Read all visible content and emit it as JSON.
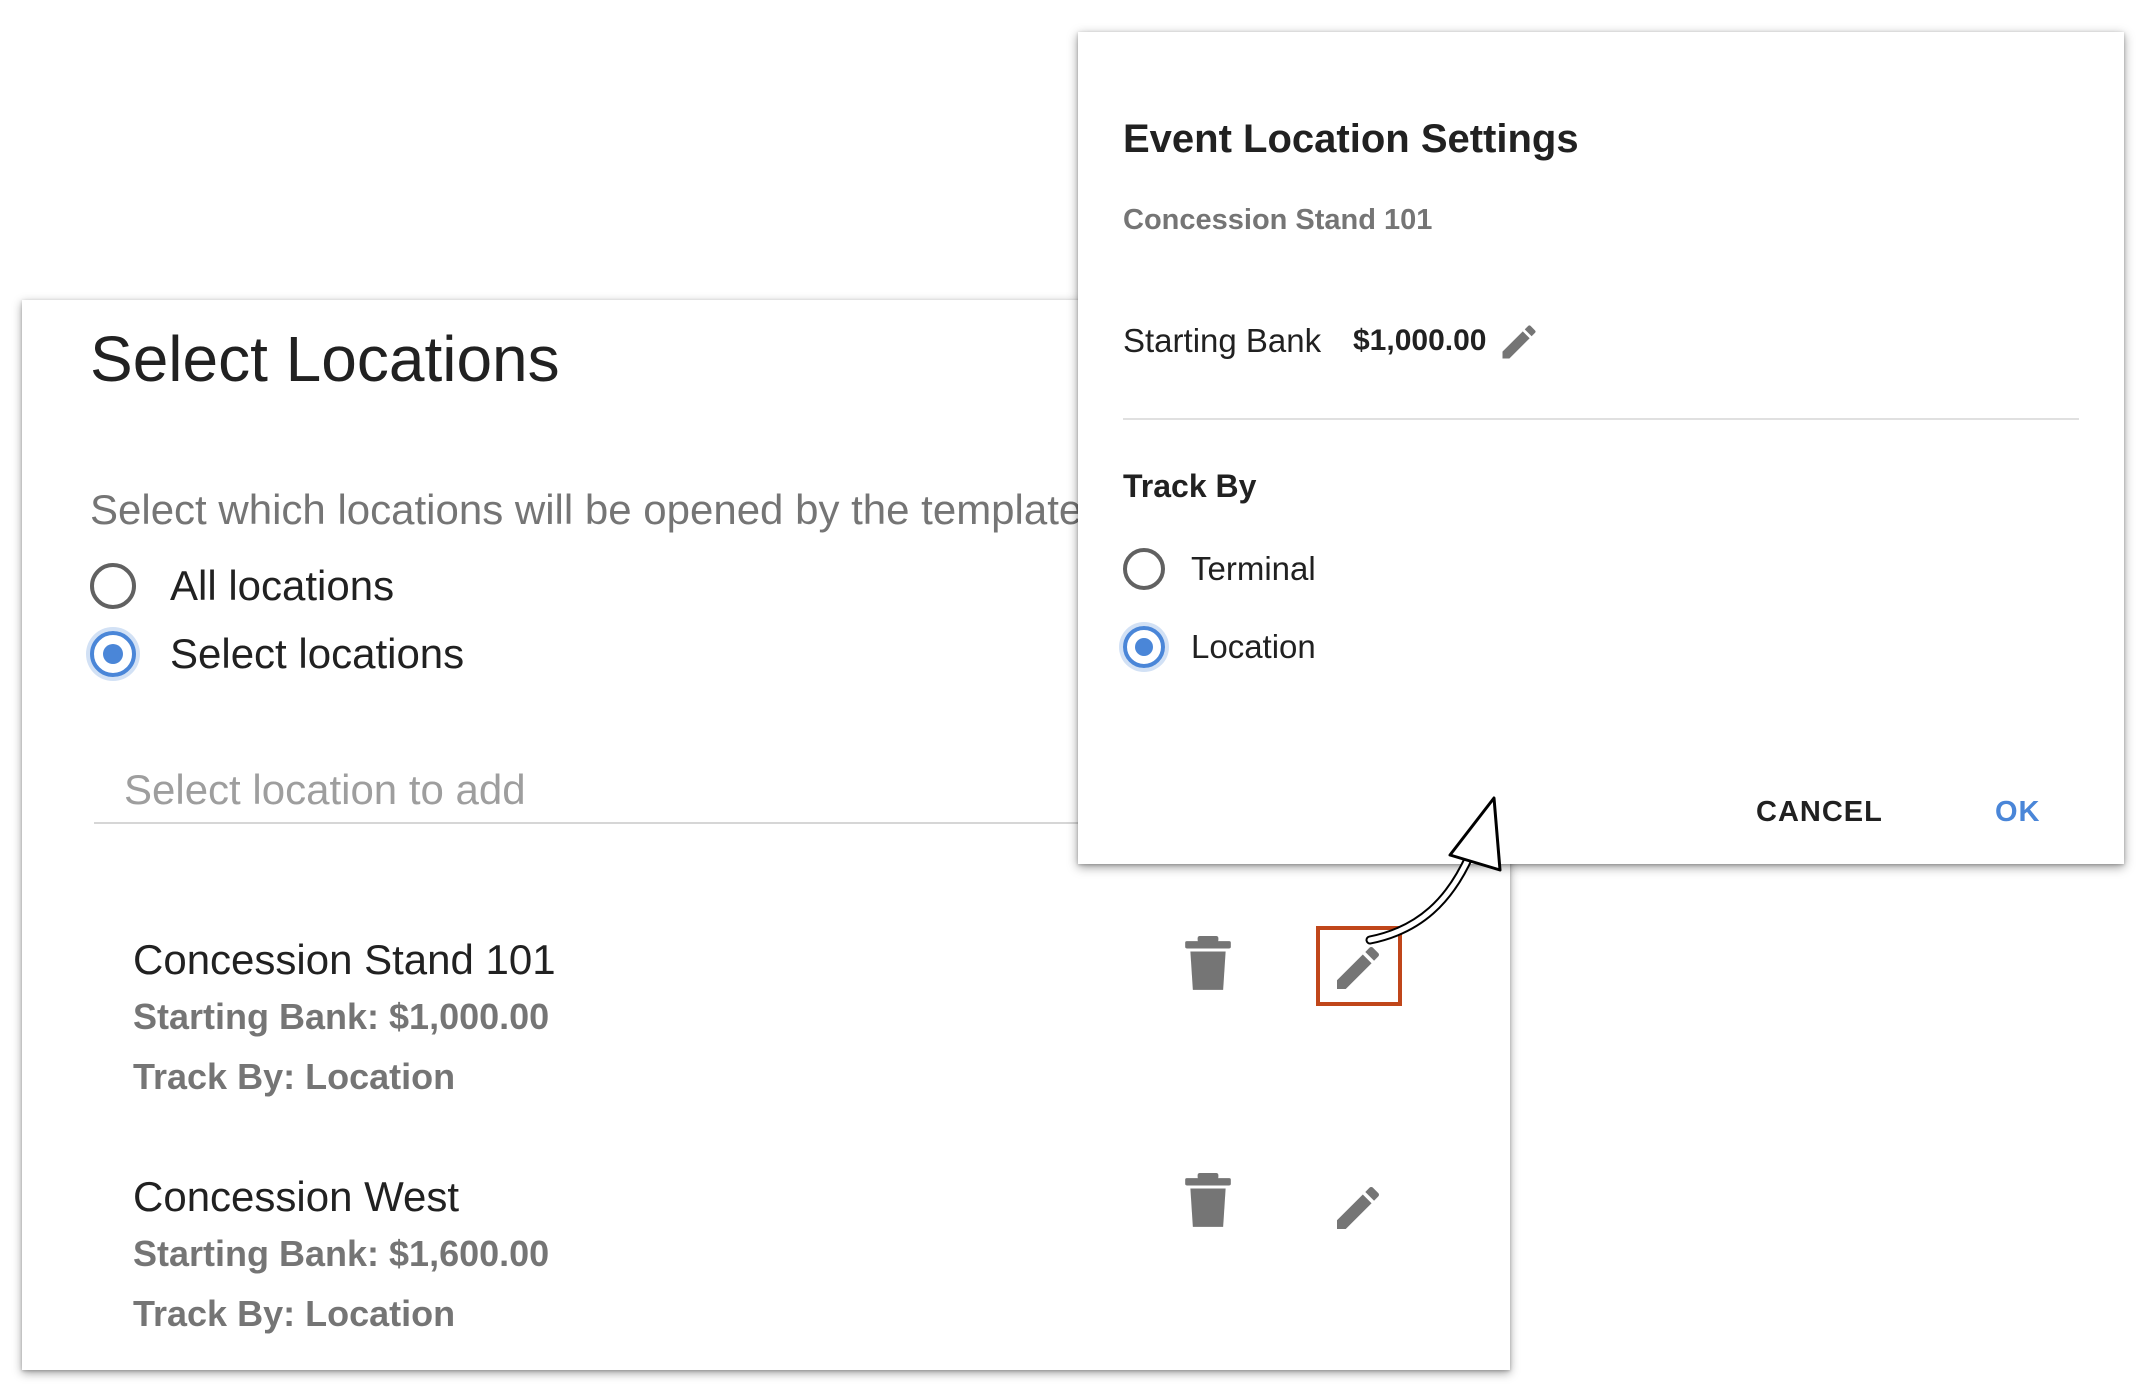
{
  "select_locations": {
    "title": "Select Locations",
    "description": "Select which locations will be opened by the template",
    "radio_options": [
      {
        "label": "All locations",
        "checked": false
      },
      {
        "label": "Select locations",
        "checked": true
      }
    ],
    "add_field": {
      "placeholder": "Select location to add",
      "value": ""
    },
    "locations": [
      {
        "name": "Concession Stand 101",
        "starting_bank": "Starting Bank: $1,000.00",
        "track_by": "Track By: Location"
      },
      {
        "name": "Concession West",
        "starting_bank": "Starting Bank: $1,600.00",
        "track_by": "Track By: Location"
      }
    ]
  },
  "dialog": {
    "title": "Event Location Settings",
    "subtitle": "Concession Stand 101",
    "starting_bank_label": "Starting Bank",
    "starting_bank_value": "$1,000.00",
    "track_by_heading": "Track By",
    "track_by_options": [
      {
        "label": "Terminal",
        "checked": false
      },
      {
        "label": "Location",
        "checked": true
      }
    ],
    "cancel_label": "CANCEL",
    "ok_label": "OK"
  },
  "icons": {
    "delete": "trash-icon",
    "edit": "pencil-icon"
  },
  "colors": {
    "accent": "#4a86d8",
    "highlight_border": "#c0461a",
    "muted_text": "#757575",
    "icon_gray": "#757575"
  }
}
